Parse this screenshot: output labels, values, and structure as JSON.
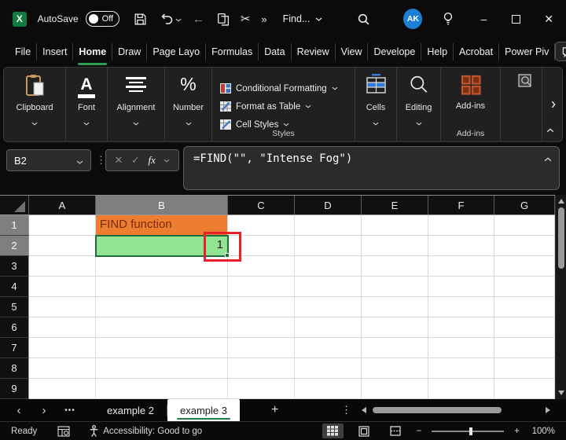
{
  "titlebar": {
    "autosave_label": "AutoSave",
    "autosave_state": "Off",
    "find_label": "Find...",
    "avatar_initials": "AK"
  },
  "icons": {
    "excel_x": "X",
    "more_chevrons": "»",
    "back_arrow": "←",
    "cut_scissors": "✂",
    "minimize": "–",
    "close": "✕",
    "font_a": "A",
    "percent": "%",
    "cancel_x": "✕",
    "check": "✓",
    "dots_vertical": "⋮",
    "dots_more": "•••",
    "nav_left": "‹",
    "nav_right": "›",
    "plus": "+",
    "zoom_minus": "−",
    "zoom_plus": "+"
  },
  "menubar": {
    "tabs": [
      {
        "label": "File",
        "active": false
      },
      {
        "label": "Insert",
        "active": false
      },
      {
        "label": "Home",
        "active": true
      },
      {
        "label": "Draw",
        "active": false
      },
      {
        "label": "Page Layo",
        "active": false
      },
      {
        "label": "Formulas",
        "active": false
      },
      {
        "label": "Data",
        "active": false
      },
      {
        "label": "Review",
        "active": false
      },
      {
        "label": "View",
        "active": false
      },
      {
        "label": "Develope",
        "active": false
      },
      {
        "label": "Help",
        "active": false
      },
      {
        "label": "Acrobat",
        "active": false
      },
      {
        "label": "Power Piv",
        "active": false
      }
    ]
  },
  "ribbon": {
    "clipboard_label": "Clipboard",
    "font_label": "Font",
    "alignment_label": "Alignment",
    "number_label": "Number",
    "styles": {
      "items": [
        "Conditional Formatting",
        "Format as Table",
        "Cell Styles"
      ],
      "group_label": "Styles"
    },
    "cells_label": "Cells",
    "editing_label": "Editing",
    "addins_label": "Add-ins",
    "addins_group_label": "Add-ins"
  },
  "formula_bar": {
    "name_box": "B2",
    "fx_label": "fx",
    "formula": "=FIND(\"\", \"Intense Fog\")"
  },
  "grid": {
    "columns": [
      "A",
      "B",
      "C",
      "D",
      "E",
      "F",
      "G"
    ],
    "rows": [
      "1",
      "2",
      "3",
      "4",
      "5",
      "6",
      "7",
      "8",
      "9"
    ],
    "selected_column": "B",
    "selected_rows": [
      "1",
      "2"
    ],
    "selected_cell": "B2",
    "cells": [
      {
        "ref": "B1",
        "text": "FIND function",
        "bg": "#ED7D31",
        "color": "#7B2C0C",
        "align": "left",
        "selected": false
      },
      {
        "ref": "B2",
        "text": "1",
        "bg": "#92E492",
        "color": "#1f1f1f",
        "align": "right",
        "selected": true
      }
    ]
  },
  "sheet_tabs": {
    "tabs": [
      {
        "label": "example 2",
        "active": false
      },
      {
        "label": "example 3",
        "active": true
      }
    ]
  },
  "status_bar": {
    "ready_label": "Ready",
    "accessibility_label": "Accessibility: Good to go",
    "zoom_label": "100%"
  },
  "colors": {
    "excel_green": "#107C41",
    "accent_green": "#2E9E57",
    "share_green": "#2DA44E",
    "avatar_blue": "#1C7FD8",
    "cell_orange": "#ED7D31",
    "cell_orange_text": "#7B2C0C",
    "cell_green": "#92E492",
    "selection_green": "#1E6F3E",
    "annotation_red": "#E8202B",
    "addins_red": "#C0562B"
  }
}
